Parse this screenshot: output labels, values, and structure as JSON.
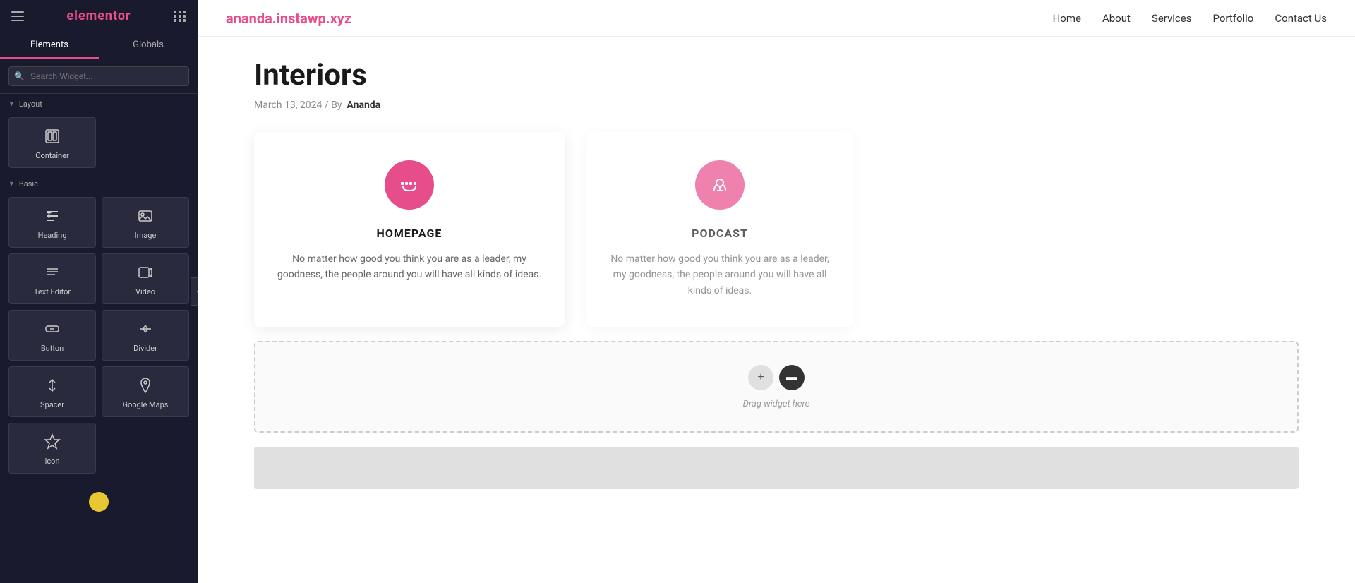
{
  "sidebar": {
    "logo": "elementor",
    "tabs": [
      {
        "label": "Elements",
        "active": true
      },
      {
        "label": "Globals",
        "active": false
      }
    ],
    "search": {
      "placeholder": "Search Widget..."
    },
    "sections": [
      {
        "title": "Layout",
        "widgets": [
          {
            "id": "container",
            "label": "Container",
            "icon": "⬜"
          },
          {
            "id": "placeholder2",
            "label": "",
            "icon": ""
          }
        ]
      },
      {
        "title": "Basic",
        "widgets": [
          {
            "id": "heading",
            "label": "Heading",
            "icon": "T"
          },
          {
            "id": "image",
            "label": "Image",
            "icon": "🖼"
          },
          {
            "id": "text-editor",
            "label": "Text Editor",
            "icon": "≡"
          },
          {
            "id": "video",
            "label": "Video",
            "icon": "▷"
          },
          {
            "id": "button",
            "label": "Button",
            "icon": "⬡"
          },
          {
            "id": "divider",
            "label": "Divider",
            "icon": "⬆"
          },
          {
            "id": "spacer",
            "label": "Spacer",
            "icon": "↕"
          },
          {
            "id": "google-maps",
            "label": "Google Maps",
            "icon": "📍"
          },
          {
            "id": "icon",
            "label": "Icon",
            "icon": "✦"
          }
        ]
      }
    ]
  },
  "topnav": {
    "logo": "ananda.instawp.xyz",
    "links": [
      {
        "label": "Home"
      },
      {
        "label": "About"
      },
      {
        "label": "Services"
      },
      {
        "label": "Portfolio"
      },
      {
        "label": "Contact Us"
      }
    ]
  },
  "page": {
    "title": "Interiors",
    "meta": "March 13, 2024  /  By",
    "author": "Ananda",
    "cards": [
      {
        "id": "homepage",
        "title": "HOMEPAGE",
        "text": "No matter how good you think you are as a leader, my goodness, the people around you will have all kinds of ideas."
      },
      {
        "id": "podcast",
        "title": "PODCAST",
        "text": "No matter how good you think you are as a leader, my goodness, the people around you will have all kinds of ideas."
      }
    ],
    "dropzone_label": "Drag widget here"
  }
}
